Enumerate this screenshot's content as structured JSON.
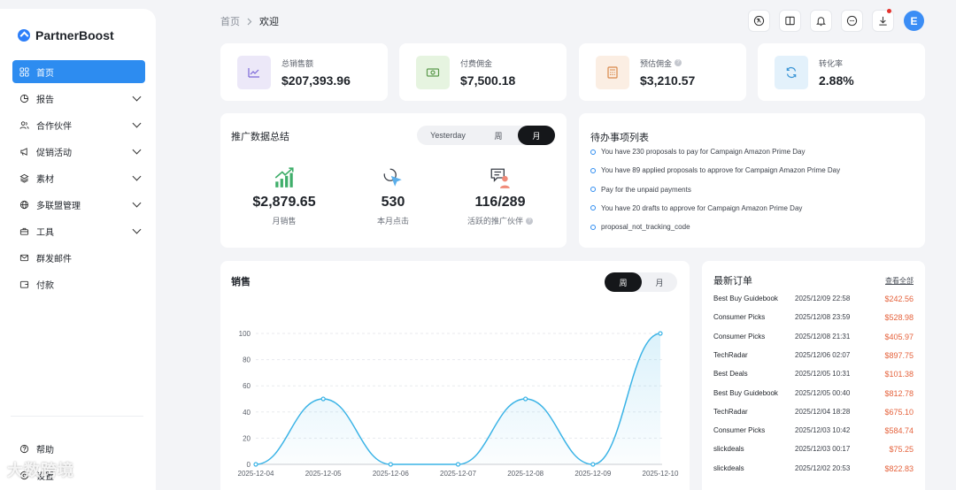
{
  "app": {
    "name": "PartnerBoost"
  },
  "sidebar": {
    "items": [
      {
        "label": "首页",
        "icon": "grid-icon",
        "active": true,
        "chevron": false
      },
      {
        "label": "报告",
        "icon": "pie-chart-icon",
        "active": false,
        "chevron": true
      },
      {
        "label": "合作伙伴",
        "icon": "users-icon",
        "active": false,
        "chevron": true
      },
      {
        "label": "促销活动",
        "icon": "megaphone-icon",
        "active": false,
        "chevron": true
      },
      {
        "label": "素材",
        "icon": "layers-icon",
        "active": false,
        "chevron": true
      },
      {
        "label": "多联盟管理",
        "icon": "globe-icon",
        "active": false,
        "chevron": true
      },
      {
        "label": "工具",
        "icon": "toolbox-icon",
        "active": false,
        "chevron": true
      },
      {
        "label": "群发邮件",
        "icon": "mail-icon",
        "active": false,
        "chevron": false
      },
      {
        "label": "付款",
        "icon": "wallet-icon",
        "active": false,
        "chevron": false
      }
    ],
    "bottom": [
      {
        "label": "帮助",
        "icon": "help-icon"
      },
      {
        "label": "设置",
        "icon": "settings-icon"
      }
    ]
  },
  "breadcrumb": {
    "home": "首页",
    "current": "欢迎"
  },
  "topbar": {
    "icons": [
      "translate-icon",
      "book-icon",
      "bell-icon",
      "chat-icon",
      "download-icon"
    ],
    "avatar_letter": "E"
  },
  "kpis": [
    {
      "label": "总销售额",
      "value": "$207,393.96",
      "icon": "trend-chart-icon",
      "bg": "#ece8f8",
      "color": "#7b68d8",
      "help": false
    },
    {
      "label": "付费佣金",
      "value": "$7,500.18",
      "icon": "cash-icon",
      "bg": "#e6f4e0",
      "color": "#5b9a4c",
      "help": false
    },
    {
      "label": "预估佣金",
      "value": "$3,210.57",
      "icon": "calculator-icon",
      "bg": "#fbeee3",
      "color": "#d9894a",
      "help": true
    },
    {
      "label": "转化率",
      "value": "2.88%",
      "icon": "refresh-icon",
      "bg": "#e3f1fb",
      "color": "#3b95d6",
      "help": false
    }
  ],
  "summary": {
    "title": "推广数据总结",
    "tabs": [
      "Yesterday",
      "周",
      "月"
    ],
    "active_tab": "月",
    "stats": [
      {
        "value": "$2,879.65",
        "label": "月销售",
        "icon": "growth-bars-icon",
        "help": false
      },
      {
        "value": "530",
        "label": "本月点击",
        "icon": "cursor-click-icon",
        "help": false
      },
      {
        "value": "116/289",
        "label": "活跃的推广伙伴",
        "icon": "partner-badge-icon",
        "help": true
      }
    ]
  },
  "todo": {
    "title": "待办事项列表",
    "items": [
      "You have 230 proposals to pay for Campaign Amazon Prime Day",
      "You have 89 applied proposals to approve for Campaign Amazon Prime Day",
      "Pay for the unpaid payments",
      "You have 20 drafts to approve for Campaign Amazon Prime Day",
      "proposal_not_tracking_code"
    ]
  },
  "sales": {
    "title": "销售",
    "tabs": [
      "周",
      "月"
    ],
    "active_tab": "周"
  },
  "chart_data": {
    "type": "area",
    "title": "",
    "xlabel": "",
    "ylabel": "",
    "categories": [
      "2025-12-04",
      "2025-12-05",
      "2025-12-06",
      "2025-12-07",
      "2025-12-08",
      "2025-12-09",
      "2025-12-10"
    ],
    "series": [
      {
        "values": [
          0,
          50,
          0,
          0,
          50,
          0,
          100
        ]
      }
    ],
    "ylim": [
      0,
      100
    ],
    "yticks": [
      0,
      20,
      40,
      60,
      80,
      100
    ],
    "grid": true,
    "line_color": "#3ab3e6"
  },
  "orders": {
    "title": "最新订单",
    "view_all": "查看全部",
    "rows": [
      {
        "store": "Best Buy Guidebook",
        "date": "2025/12/09 22:58",
        "amount": "$242.56"
      },
      {
        "store": "Consumer Picks",
        "date": "2025/12/08 23:59",
        "amount": "$528.98"
      },
      {
        "store": "Consumer Picks",
        "date": "2025/12/08 21:31",
        "amount": "$405.97"
      },
      {
        "store": "TechRadar",
        "date": "2025/12/06 02:07",
        "amount": "$897.75"
      },
      {
        "store": "Best Deals",
        "date": "2025/12/05 10:31",
        "amount": "$101.38"
      },
      {
        "store": "Best Buy Guidebook",
        "date": "2025/12/05 00:40",
        "amount": "$812.78"
      },
      {
        "store": "TechRadar",
        "date": "2025/12/04 18:28",
        "amount": "$675.10"
      },
      {
        "store": "Consumer Picks",
        "date": "2025/12/03 10:42",
        "amount": "$584.74"
      },
      {
        "store": "slickdeals",
        "date": "2025/12/03 00:17",
        "amount": "$75.25"
      },
      {
        "store": "slickdeals",
        "date": "2025/12/02 20:53",
        "amount": "$822.83"
      }
    ]
  },
  "watermark": "大数跨境"
}
